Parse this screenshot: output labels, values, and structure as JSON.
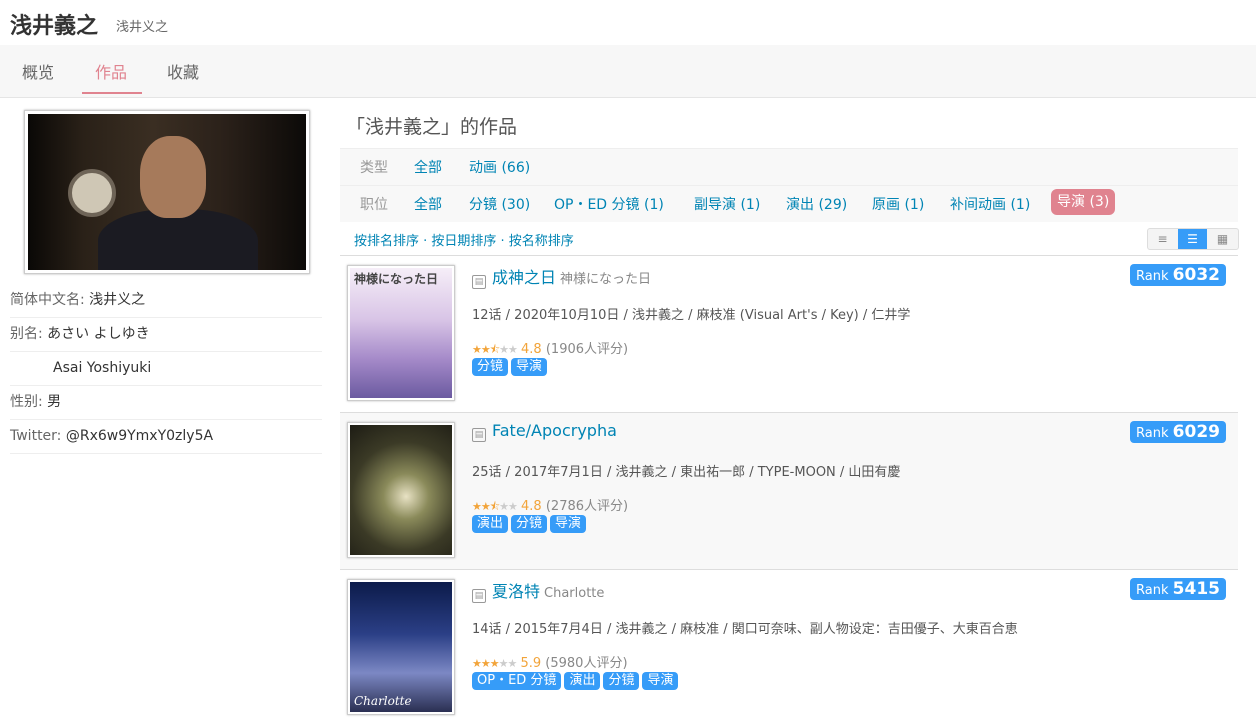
{
  "person": {
    "name": "浅井義之",
    "name_cn": "浅井义之"
  },
  "tabs": [
    "概览",
    "作品",
    "收藏"
  ],
  "info": [
    {
      "k": "简体中文名: ",
      "v": "浅井义之"
    },
    {
      "k": "别名: ",
      "v": "あさい よしゆき"
    },
    {
      "k": "",
      "v": "Asai Yoshiyuki"
    },
    {
      "k": "性别: ",
      "v": "男"
    },
    {
      "k": "Twitter: ",
      "v": "@Rx6w9YmxY0zly5A"
    }
  ],
  "works_title": "「浅井義之」的作品",
  "filter_type": {
    "label": "类型",
    "items": [
      "全部",
      "动画 (66)"
    ]
  },
  "filter_role": {
    "label": "职位",
    "items": [
      "全部",
      "分镜 (30)",
      "OP・ED 分镜 (1)",
      "副导演 (1)",
      "演出 (29)",
      "原画 (1)",
      "补间动画 (1)",
      "导演 (3)"
    ]
  },
  "sort_text": "按排名排序 · 按日期排序 · 按名称排序",
  "view_icons": [
    "≡",
    "☰",
    "▦"
  ],
  "works": [
    {
      "title": "成神之日",
      "orig": "神様になった日",
      "meta": "12话 / 2020年10月10日 / 浅井義之 / 麻枝准 (Visual Art's / Key) / 仁井学",
      "stars": 2.5,
      "score": "4.8",
      "votes": "(1906人评分)",
      "tags": [
        "分镜",
        "导演"
      ],
      "rank_label": "Rank",
      "rank": "6032",
      "cover_text": "神様になった日",
      "cover_bg": "#e7d9ec"
    },
    {
      "title": "Fate/Apocrypha",
      "orig": "",
      "meta": "25话 / 2017年7月1日 / 浅井義之 / 東出祐一郎 / TYPE-MOON / 山田有慶",
      "stars": 2.5,
      "score": "4.8",
      "votes": "(2786人评分)",
      "tags": [
        "演出",
        "分镜",
        "导演"
      ],
      "rank_label": "Rank",
      "rank": "6029",
      "cover_text": "",
      "cover_bg": "#4a4a32"
    },
    {
      "title": "夏洛特",
      "orig": "Charlotte",
      "meta": "14话 / 2015年7月4日 / 浅井義之 / 麻枝准 / 関口可奈味、副人物设定：吉田優子、大東百合恵",
      "stars": 3,
      "score": "5.9",
      "votes": "(5980人评分)",
      "tags": [
        "OP・ED 分镜",
        "演出",
        "分镜",
        "导演"
      ],
      "rank_label": "Rank",
      "rank": "5415",
      "cover_text": "Charlotte",
      "cover_bg": "#1f2a5a"
    }
  ]
}
